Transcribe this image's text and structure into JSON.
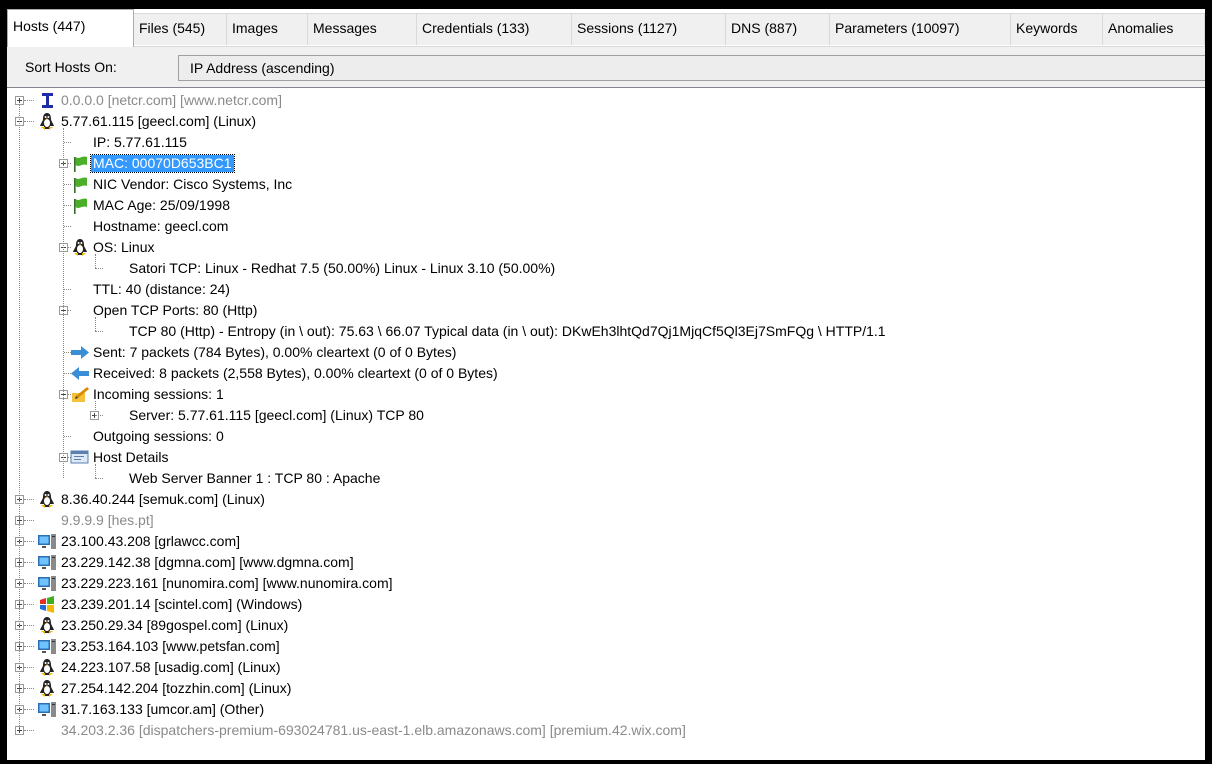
{
  "tabs": [
    {
      "label": "Hosts (447)",
      "active": true
    },
    {
      "label": "Files (545)"
    },
    {
      "label": "Images"
    },
    {
      "label": "Messages"
    },
    {
      "label": "Credentials (133)"
    },
    {
      "label": "Sessions (1127)"
    },
    {
      "label": "DNS (887)"
    },
    {
      "label": "Parameters (10097)"
    },
    {
      "label": "Keywords"
    },
    {
      "label": "Anomalies"
    }
  ],
  "sort": {
    "label": "Sort Hosts On:",
    "value": "IP Address (ascending)"
  },
  "tree": [
    {
      "text": "0.0.0.0 [netcr.com] [www.netcr.com]",
      "icon": "network-device-icon",
      "level": 0,
      "expander": "plus",
      "gray": true
    },
    {
      "text": "5.77.61.115 [geecl.com] (Linux)",
      "icon": "linux-tux-icon",
      "level": 0,
      "expander": "minus"
    },
    {
      "text": "IP: 5.77.61.115",
      "level": 1
    },
    {
      "text": "MAC: 00070D653BC1",
      "icon": "flag-icon",
      "level": 1,
      "expander": "plus",
      "selected": true
    },
    {
      "text": "NIC Vendor: Cisco Systems, Inc",
      "icon": "flag-icon",
      "level": 1
    },
    {
      "text": "MAC Age: 25/09/1998",
      "icon": "flag-icon",
      "level": 1
    },
    {
      "text": "Hostname: geecl.com",
      "level": 1
    },
    {
      "text": "OS: Linux",
      "icon": "linux-tux-icon",
      "level": 1,
      "expander": "minus"
    },
    {
      "text": "Satori TCP: Linux - Redhat 7.5 (50.00%) Linux - Linux 3.10 (50.00%)",
      "level": 2
    },
    {
      "text": "TTL: 40 (distance: 24)",
      "level": 1
    },
    {
      "text": "Open TCP Ports: 80 (Http)",
      "level": 1,
      "expander": "minus"
    },
    {
      "text": "TCP 80 (Http) - Entropy (in \\ out): 75.63 \\ 66.07 Typical data (in \\ out): DKwEh3lhtQd7Qj1MjqCf5Ql3Ej7SmFQg \\ HTTP/1.1",
      "level": 2
    },
    {
      "text": "Sent: 7 packets (784 Bytes), 0.00% cleartext (0 of 0 Bytes)",
      "icon": "sent-arrow-icon",
      "level": 1
    },
    {
      "text": "Received: 8 packets (2,558 Bytes), 0.00% cleartext (0 of 0 Bytes)",
      "icon": "received-arrow-icon",
      "level": 1
    },
    {
      "text": "Incoming sessions: 1",
      "icon": "incoming-sessions-icon",
      "level": 1,
      "expander": "minus"
    },
    {
      "text": "Server: 5.77.61.115 [geecl.com] (Linux) TCP 80",
      "level": 2,
      "expander": "plus"
    },
    {
      "text": "Outgoing sessions: 0",
      "level": 1
    },
    {
      "text": "Host Details",
      "icon": "host-details-icon",
      "level": 1,
      "expander": "minus"
    },
    {
      "text": "Web Server Banner 1 : TCP 80 : Apache",
      "level": 2
    },
    {
      "text": "8.36.40.244 [semuk.com] (Linux)",
      "icon": "linux-tux-icon",
      "level": 0,
      "expander": "plus"
    },
    {
      "text": "9.9.9.9 [hes.pt]",
      "level": 0,
      "expander": "plus",
      "gray": true
    },
    {
      "text": "23.100.43.208 [grlawcc.com]",
      "icon": "computer-icon",
      "level": 0,
      "expander": "plus"
    },
    {
      "text": "23.229.142.38 [dgmna.com] [www.dgmna.com]",
      "icon": "computer-icon",
      "level": 0,
      "expander": "plus"
    },
    {
      "text": "23.229.223.161 [nunomira.com] [www.nunomira.com]",
      "icon": "computer-icon",
      "level": 0,
      "expander": "plus"
    },
    {
      "text": "23.239.201.14 [scintel.com] (Windows)",
      "icon": "windows-logo-icon",
      "level": 0,
      "expander": "plus"
    },
    {
      "text": "23.250.29.34 [89gospel.com] (Linux)",
      "icon": "linux-tux-icon",
      "level": 0,
      "expander": "plus"
    },
    {
      "text": "23.253.164.103 [www.petsfan.com]",
      "icon": "computer-icon",
      "level": 0,
      "expander": "plus"
    },
    {
      "text": "24.223.107.58 [usadig.com] (Linux)",
      "icon": "linux-tux-icon",
      "level": 0,
      "expander": "plus"
    },
    {
      "text": "27.254.142.204 [tozzhin.com] (Linux)",
      "icon": "linux-tux-icon",
      "level": 0,
      "expander": "plus"
    },
    {
      "text": "31.7.163.133 [umcor.am] (Other)",
      "icon": "computer-icon",
      "level": 0,
      "expander": "plus"
    },
    {
      "text": "34.203.2.36 [dispatchers-premium-693024781.us-east-1.elb.amazonaws.com] [premium.42.wix.com]",
      "level": 0,
      "expander": "plus",
      "gray": true
    }
  ]
}
